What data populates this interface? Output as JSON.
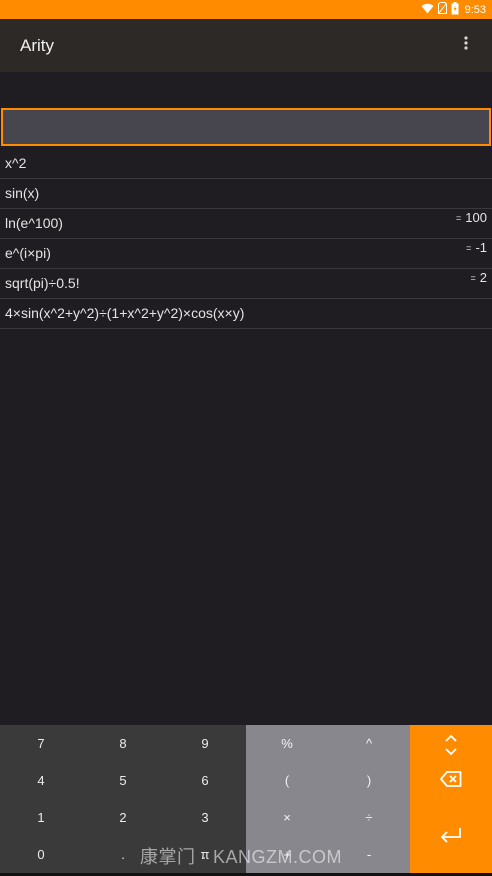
{
  "status_bar": {
    "time": "9:53",
    "icons": [
      "wifi-icon",
      "sim-icon",
      "battery-icon"
    ],
    "color": "#ff8c00"
  },
  "app_bar": {
    "title": "Arity",
    "overflow_icon": "more-vert-icon",
    "background": "#2d2926"
  },
  "input": {
    "value": "",
    "accent_color": "#ff8c00"
  },
  "history": [
    {
      "expression": "x^2",
      "result": ""
    },
    {
      "expression": "sin(x)",
      "result": ""
    },
    {
      "expression": "ln(e^100)",
      "result": "100"
    },
    {
      "expression": "e^(i×pi)",
      "result": "-1"
    },
    {
      "expression": "sqrt(pi)÷0.5!",
      "result": "2"
    },
    {
      "expression": "4×sin(x^2+y^2)÷(1+x^2+y^2)×cos(x×y)",
      "result": ""
    }
  ],
  "result_prefix": "=",
  "keypad": {
    "numbers": [
      "7",
      "8",
      "9",
      "4",
      "5",
      "6",
      "1",
      "2",
      "3",
      "0",
      ".",
      "π"
    ],
    "operators": [
      "%",
      "^",
      "(",
      ")",
      "×",
      "÷",
      "+",
      "-"
    ],
    "actions": [
      "expand-icon",
      "backspace-icon",
      "enter-icon"
    ],
    "numpad_color": "#3a3a3a",
    "oppad_color": "#87878d",
    "action_color": "#ff8c00"
  },
  "watermark": "康掌门 · KANGZM.COM"
}
